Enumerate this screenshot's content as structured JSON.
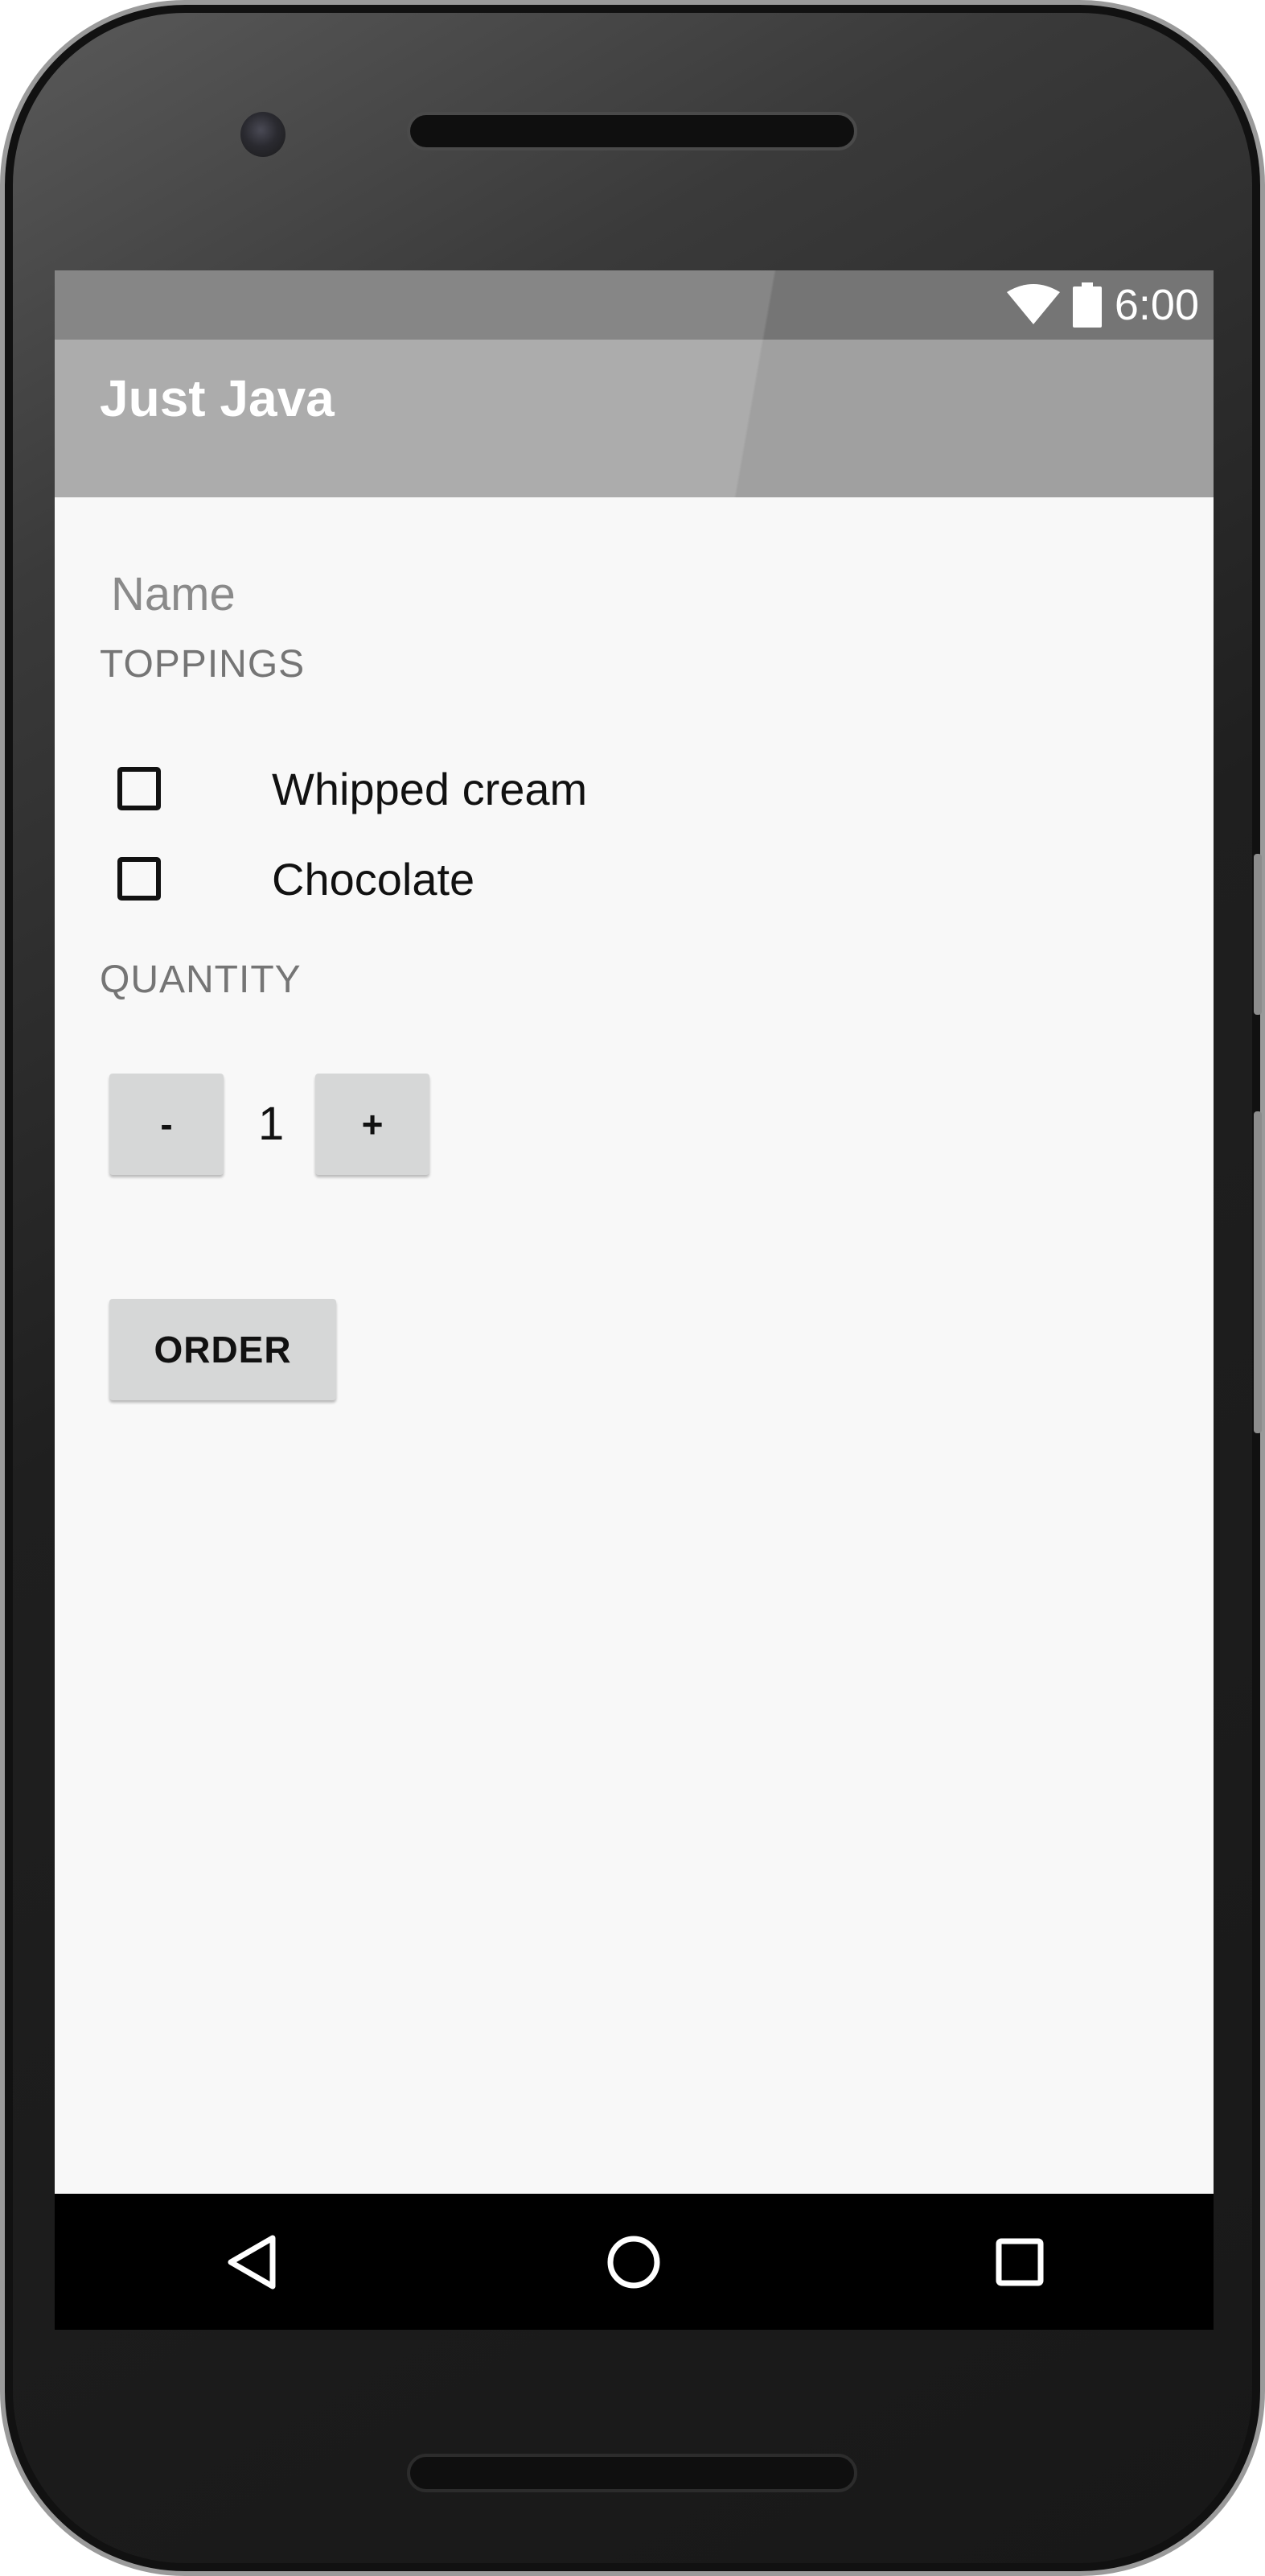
{
  "status_bar": {
    "time": "6:00",
    "icons": [
      "wifi-icon",
      "battery-icon"
    ]
  },
  "app_bar": {
    "title": "Just Java"
  },
  "form": {
    "name_placeholder": "Name",
    "name_value": "",
    "toppings_label": "TOPPINGS",
    "toppings": [
      {
        "label": "Whipped cream",
        "checked": false
      },
      {
        "label": "Chocolate",
        "checked": false
      }
    ],
    "quantity_label": "QUANTITY",
    "decrement_label": "-",
    "quantity": "1",
    "increment_label": "+",
    "order_label": "ORDER"
  },
  "nav_bar": {
    "icons": [
      "back-icon",
      "home-icon",
      "recents-icon"
    ]
  },
  "colors": {
    "status_bar": "#757575",
    "app_bar": "#a0a0a0",
    "background": "#f8f8f8",
    "button": "#d6d7d7"
  }
}
